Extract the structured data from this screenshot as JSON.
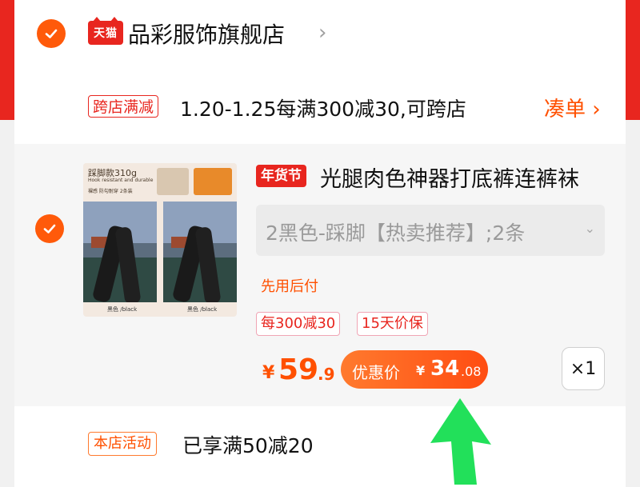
{
  "store": {
    "logo_text": "天猫",
    "name": "品彩服饰旗舰店",
    "chevron": "›"
  },
  "promo": {
    "tag": "跨店满减",
    "text": "1.20-1.25每满300减30,可跨店",
    "action": "凑单 ›"
  },
  "item": {
    "thumbnail": {
      "title": "踩脚款310g",
      "subtitle": "Hook resistant and durable",
      "features": "裸感 防勾耐穿   2条装",
      "color_caption": "黑色 /black"
    },
    "badge": "年货节",
    "title": "光腿肉色神器打底裤连裤袜",
    "sku": "2黑色-踩脚【热卖推荐】;2条",
    "sku_chevron": "⌄",
    "pay_later": "先用后付",
    "tags": [
      "每300减30",
      "15天价保"
    ],
    "price": {
      "currency": "¥",
      "integer": "59",
      "decimal": ".9"
    },
    "coupon_price": {
      "label": "优惠价",
      "currency": "¥",
      "integer": "34",
      "decimal": ".08"
    },
    "quantity": "×1"
  },
  "activity": {
    "tag": "本店活动",
    "text": "已享满50减20"
  },
  "colors": {
    "accent": "#ff5000",
    "brand_red": "#e8261f",
    "arrow_green": "#22e05a"
  },
  "icons": {
    "store_checkbox": "check-icon",
    "item_checkbox": "check-icon",
    "overlay": "green-arrow-icon"
  }
}
